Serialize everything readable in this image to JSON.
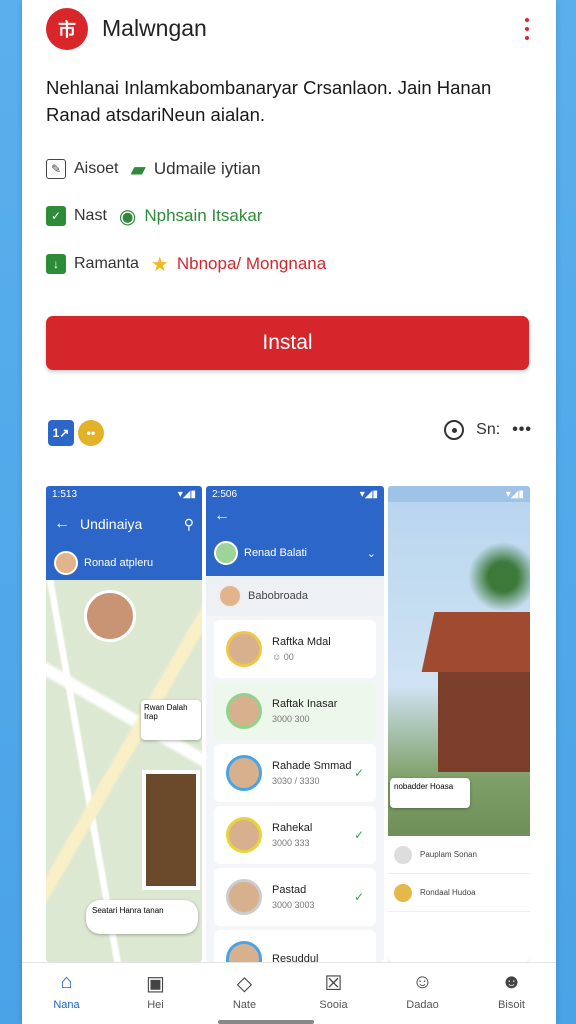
{
  "app": {
    "title": "Malwngan",
    "logo_glyph": "市",
    "description": "Nehlanai Inlamkabombanaryar Crsanlaon. Jain Hanan Ranad atsdariNeun aialan."
  },
  "meta": [
    {
      "label": "Aisoet",
      "value": "Udmaile iytian",
      "label_icon": "edit-icon",
      "value_icon": "chat-icon",
      "value_color": "#333333"
    },
    {
      "label": "Nast",
      "value": "Nphsain Itsakar",
      "label_icon": "check-icon",
      "value_icon": "location-icon",
      "value_color": "#2e8b3a"
    },
    {
      "label": "Ramanta",
      "value": "Nbnopa/ Mongnana",
      "label_icon": "download-icon",
      "value_icon": "star-icon",
      "value_color": "#d4262b"
    }
  ],
  "install_button": "Instal",
  "toolbar": {
    "badge1": "1↗",
    "badge2": "••",
    "share_label": "Sn:",
    "more": "•••"
  },
  "screenshots": {
    "shot1": {
      "time": "1:513",
      "title": "Undinaiya",
      "chat_name": "Ronad atpleru",
      "card_text": "Rwan Dalah Irap",
      "bubble_text": "Seatari Hanra tanan"
    },
    "shot2": {
      "time": "2:506",
      "header": "Renad Balati",
      "sub": "Babobroada",
      "items": [
        {
          "name": "Raftka Mdal",
          "sub": "☺ 00"
        },
        {
          "name": "Raftak Inasar",
          "sub": "3000 300"
        },
        {
          "name": "Rahade Smmad",
          "sub": "3030 / 3330"
        },
        {
          "name": "Rahekal",
          "sub": "3000 333"
        },
        {
          "name": "Pastad",
          "sub": "3000 3003"
        },
        {
          "name": "Resuddul",
          "sub": ""
        }
      ]
    },
    "shot3": {
      "card_text": "nobadder Hoasa",
      "list": [
        "Pauplam Sonan",
        "Rondaal Hudoa"
      ]
    }
  },
  "bottom_nav": [
    {
      "label": "Nana",
      "icon": "home-icon",
      "glyph": "⌂",
      "active": true
    },
    {
      "label": "Hei",
      "icon": "gallery-icon",
      "glyph": "▣",
      "active": false
    },
    {
      "label": "Nate",
      "icon": "diamond-icon",
      "glyph": "◇",
      "active": false
    },
    {
      "label": "Sooia",
      "icon": "box-icon",
      "glyph": "☒",
      "active": false
    },
    {
      "label": "Dadao",
      "icon": "group-icon",
      "glyph": "☺",
      "active": false
    },
    {
      "label": "Bisoit",
      "icon": "profile-icon",
      "glyph": "☻",
      "active": false
    }
  ],
  "colors": {
    "brand_red": "#d4262b",
    "accent_blue": "#2c66c8",
    "green": "#2e8b3a"
  }
}
